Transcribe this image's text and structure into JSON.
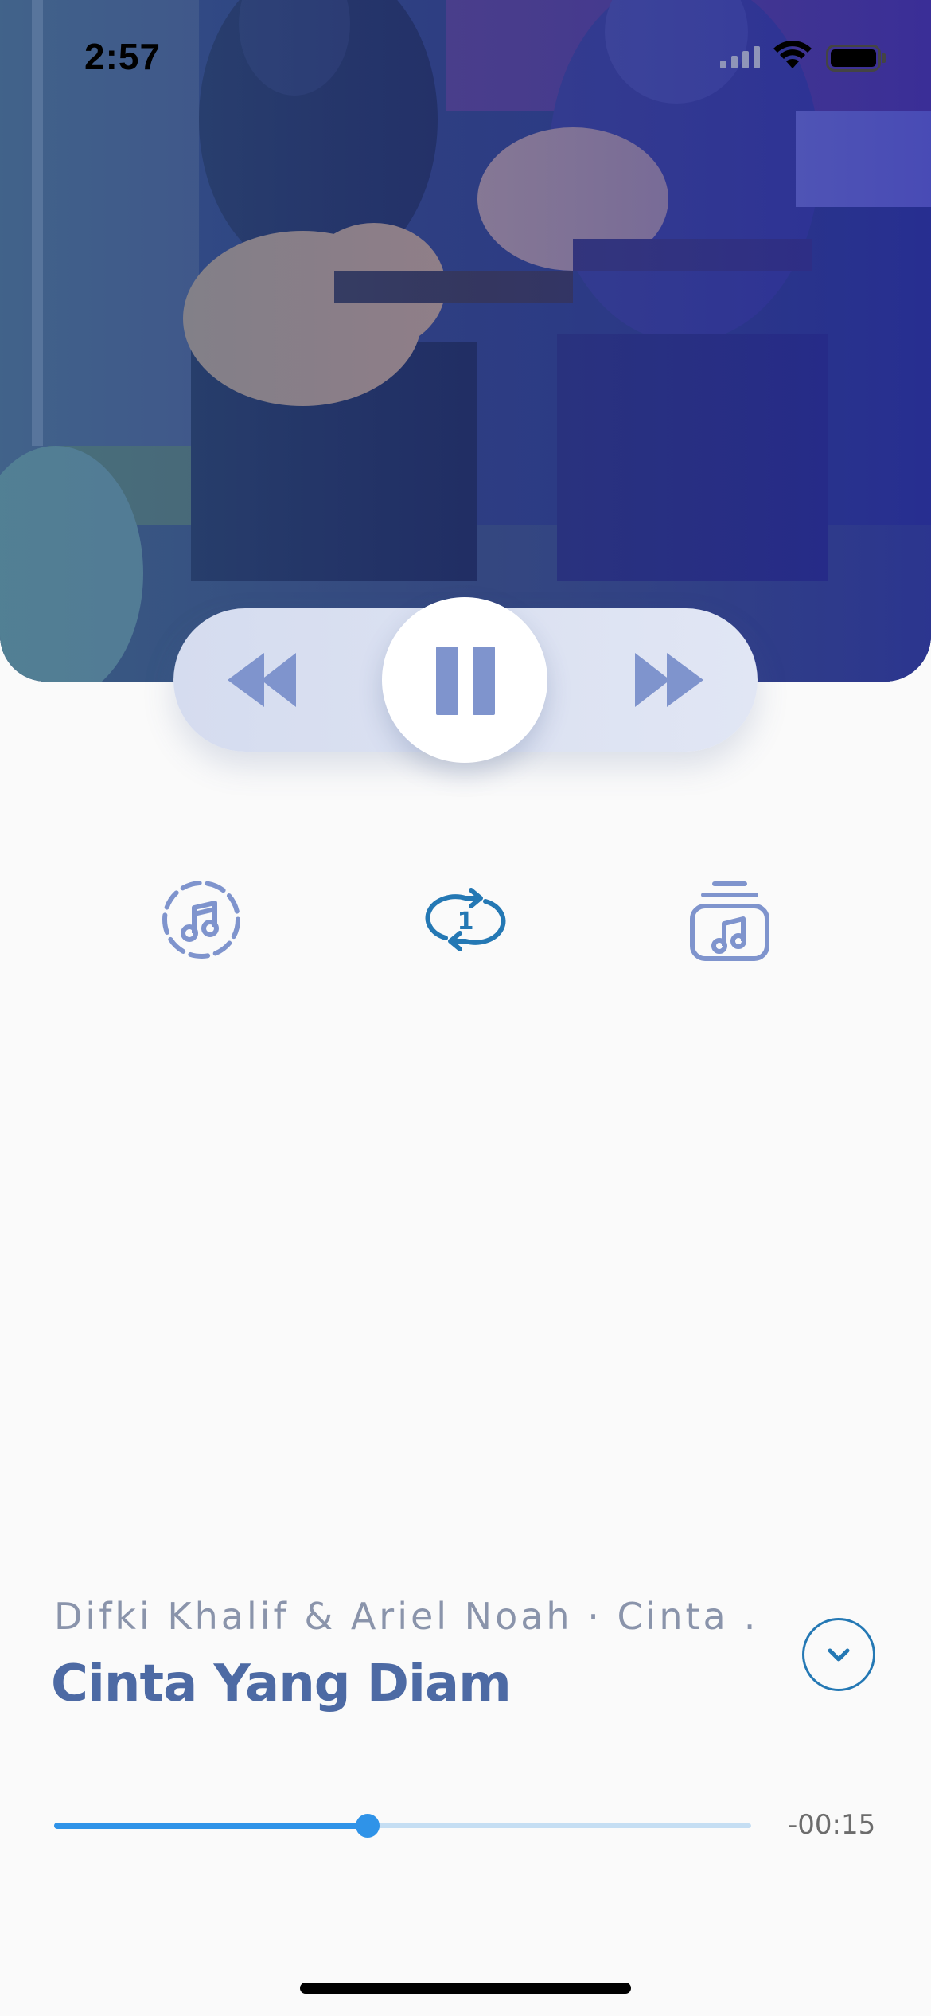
{
  "status_bar": {
    "time": "2:57",
    "icons": [
      "cellular-signal-icon",
      "wifi-icon",
      "battery-icon"
    ]
  },
  "artwork": {
    "description_icon": "album-artwork-image"
  },
  "transport": {
    "rewind_icon": "rewind-icon",
    "pause_icon": "pause-icon",
    "forward_icon": "fast-forward-icon"
  },
  "modes": [
    {
      "icon": "shuffle-music-icon"
    },
    {
      "icon": "repeat-one-icon",
      "badge": "1"
    },
    {
      "icon": "playlist-queue-icon"
    }
  ],
  "song": {
    "artist_album": "Difki Khalif & Ariel Noah · Cinta …",
    "title": "Cinta Yang Diam"
  },
  "progress": {
    "fraction": 0.45,
    "remaining": "-00:15"
  },
  "colors": {
    "accent": "#2f93e8",
    "title": "#4d6aa4",
    "control_icon": "#7f94cd",
    "repeat_icon": "#2478b4"
  }
}
